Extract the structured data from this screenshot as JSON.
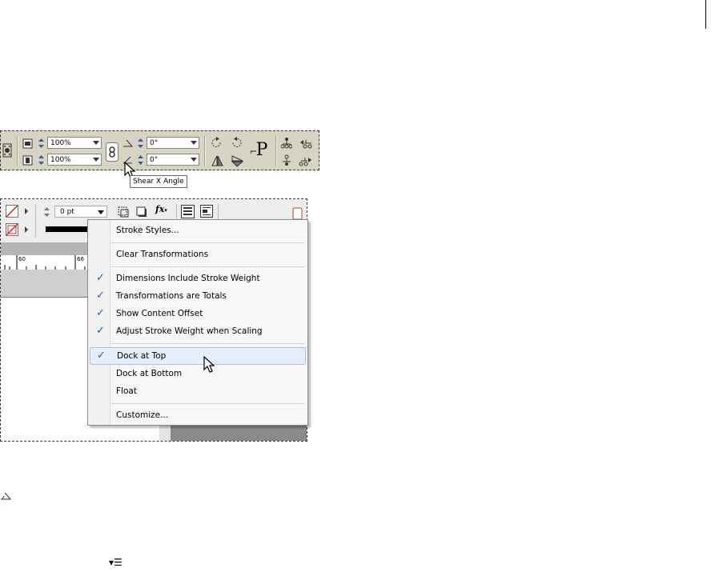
{
  "control_panel": {
    "scale_x": "100%",
    "scale_y": "100%",
    "rotation_angle": "0°",
    "shear_angle": "0°",
    "paragraph_icon_label": "P",
    "tooltip": "Shear X Angle"
  },
  "stroke_bar": {
    "weight": "0 pt"
  },
  "ruler": {
    "ticks": [
      "60",
      "66"
    ]
  },
  "menu": {
    "items": [
      {
        "label": "Stroke Styles...",
        "checked": false
      },
      {
        "label": "Clear Transformations",
        "checked": false
      },
      {
        "label": "Dimensions Include Stroke Weight",
        "checked": true
      },
      {
        "label": "Transformations are Totals",
        "checked": true
      },
      {
        "label": "Show Content Offset",
        "checked": true
      },
      {
        "label": "Adjust Stroke Weight when Scaling",
        "checked": true
      },
      {
        "label": "Dock at Top",
        "checked": true,
        "highlighted": true
      },
      {
        "label": "Dock at Bottom",
        "checked": false
      },
      {
        "label": "Float",
        "checked": false
      },
      {
        "label": "Customize...",
        "checked": false
      }
    ],
    "check_glyph": "✓"
  },
  "footer_icons": {
    "menu_icon_glyph": "▾☰"
  }
}
